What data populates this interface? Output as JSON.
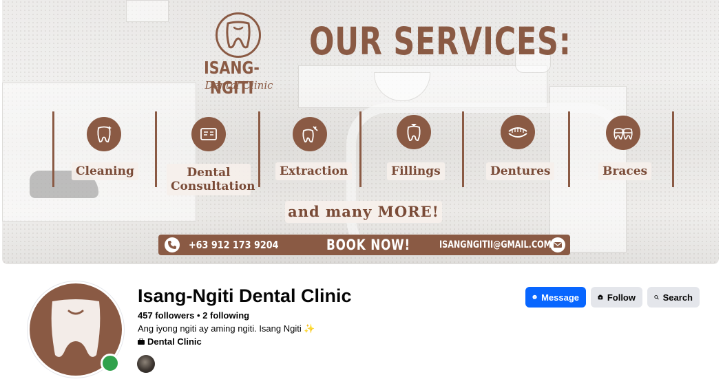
{
  "cover": {
    "brand_name": "ISANG-NGITI",
    "brand_sub": "Dental Clinic",
    "headline": "OUR SERVICES:",
    "services": [
      {
        "label": "Cleaning",
        "icon": "tooth-sparkle-icon"
      },
      {
        "label": "Dental Consultation",
        "icon": "consultation-card-icon"
      },
      {
        "label": "Extraction",
        "icon": "tooth-extraction-icon"
      },
      {
        "label": "Fillings",
        "icon": "tooth-filling-icon"
      },
      {
        "label": "Dentures",
        "icon": "dentures-icon"
      },
      {
        "label": "Braces",
        "icon": "braces-icon"
      }
    ],
    "more": "and many MORE!",
    "phone": "+63 912 173 9204",
    "book": "BOOK NOW!",
    "email": "ISANGNGITII@GMAIL.COM",
    "accent": "#8a5a44"
  },
  "profile": {
    "name": "Isang-Ngiti Dental Clinic",
    "followers": "457 followers",
    "separator": "•",
    "following": "2 following",
    "bio": "Ang iyong ngiti ay aming ngiti. Isang Ngiti ✨",
    "category": "Dental Clinic",
    "online_color": "#31a24c"
  },
  "actions": {
    "message": "Message",
    "follow": "Follow",
    "search": "Search",
    "primary_color": "#0866ff"
  }
}
